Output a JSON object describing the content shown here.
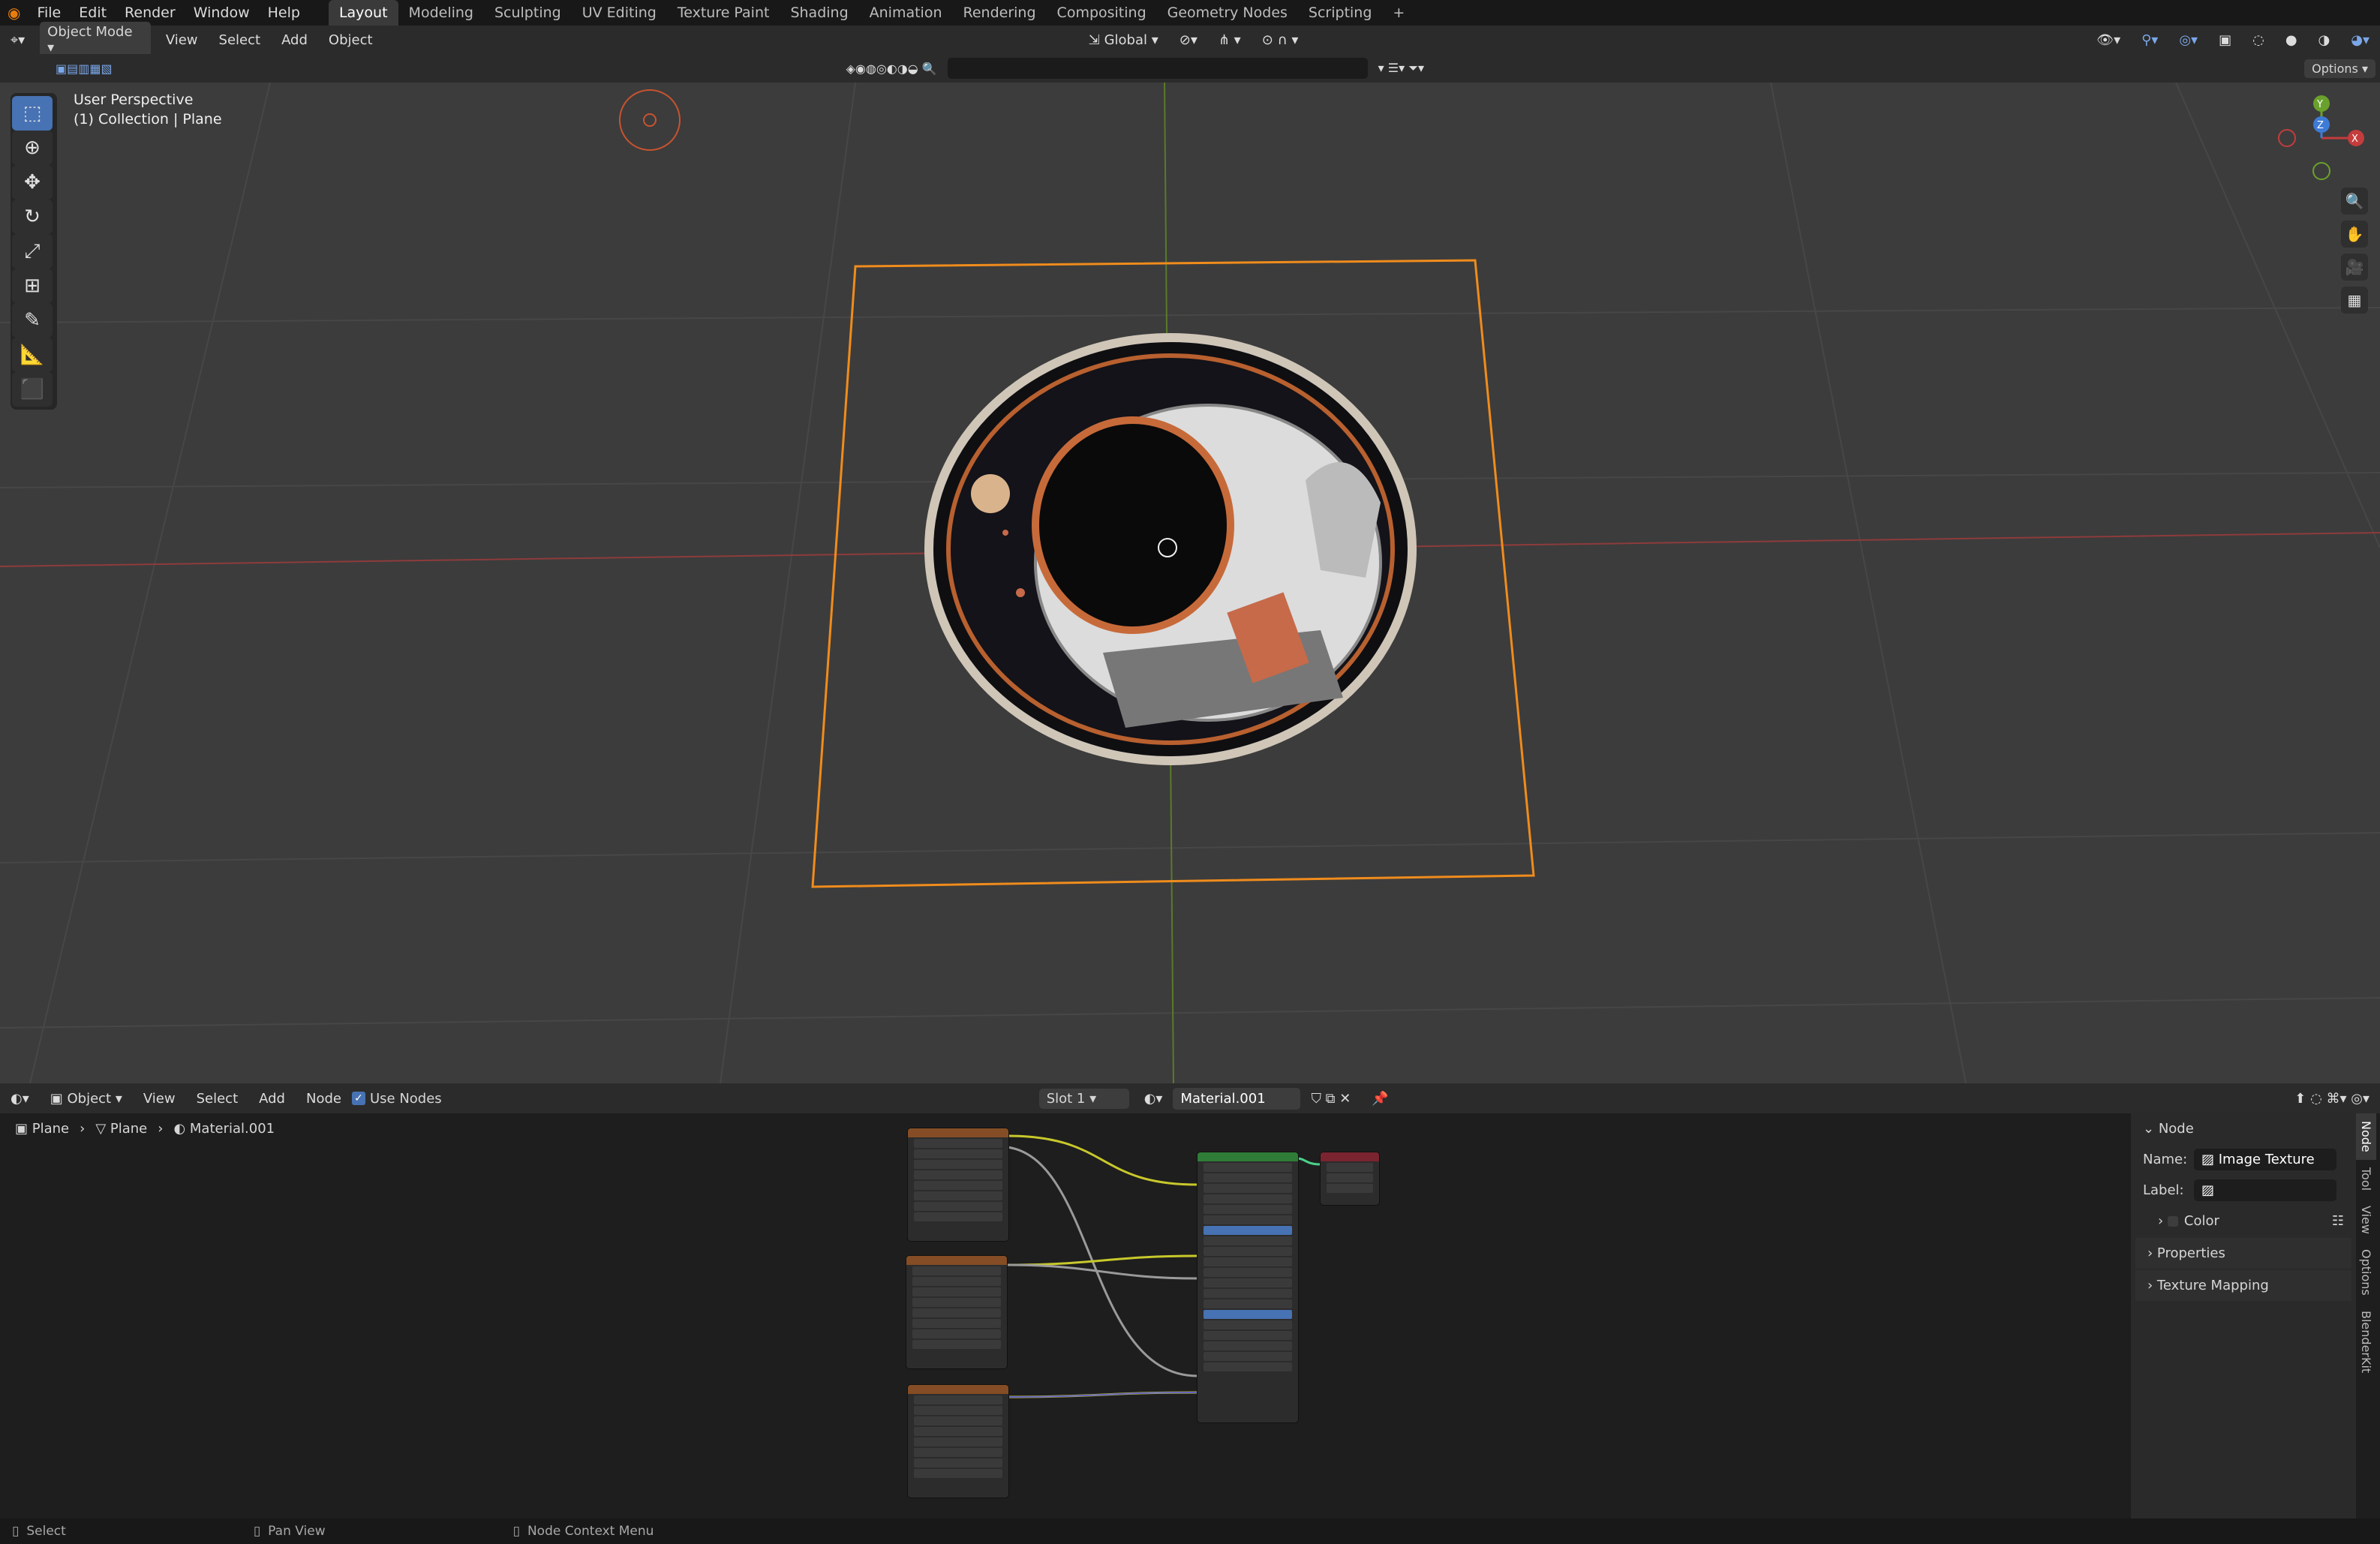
{
  "topbar": {
    "menus": [
      "File",
      "Edit",
      "Render",
      "Window",
      "Help"
    ],
    "workspaces": [
      "Layout",
      "Modeling",
      "Sculpting",
      "UV Editing",
      "Texture Paint",
      "Shading",
      "Animation",
      "Rendering",
      "Compositing",
      "Geometry Nodes",
      "Scripting"
    ],
    "active_workspace": "Layout",
    "add_tab": "+"
  },
  "viewport_header": {
    "mode": "Object Mode",
    "menus": [
      "View",
      "Select",
      "Add",
      "Object"
    ],
    "transform_orientation": "Global",
    "options_label": "Options"
  },
  "viewport": {
    "view_name": "User Perspective",
    "collection_info": "(1) Collection | Plane",
    "gizmo_axes": {
      "x": "X",
      "y": "Y",
      "z": "Z"
    },
    "colors": {
      "selection_outline": "#f08c1c",
      "x_axis": "#c43c3c",
      "y_axis": "#6aa12c",
      "background": "#3c3c3c"
    }
  },
  "node_header": {
    "editor_type": "Object",
    "menus": [
      "View",
      "Select",
      "Add",
      "Node"
    ],
    "use_nodes_label": "Use Nodes",
    "use_nodes_checked": true,
    "slot": "Slot 1",
    "material": "Material.001"
  },
  "breadcrumb": [
    "Plane",
    "Plane",
    "Material.001"
  ],
  "sidebar": {
    "panel_title": "Node",
    "name_label": "Name:",
    "name_value": "Image Texture",
    "label_label": "Label:",
    "label_value": "",
    "sections": [
      "Color",
      "Properties",
      "Texture Mapping"
    ],
    "tabs": [
      "Node",
      "Tool",
      "View",
      "Options",
      "BlenderKit"
    ],
    "active_tab": "Node"
  },
  "statusbar": {
    "items": [
      "Select",
      "Pan View",
      "Node Context Menu"
    ]
  }
}
